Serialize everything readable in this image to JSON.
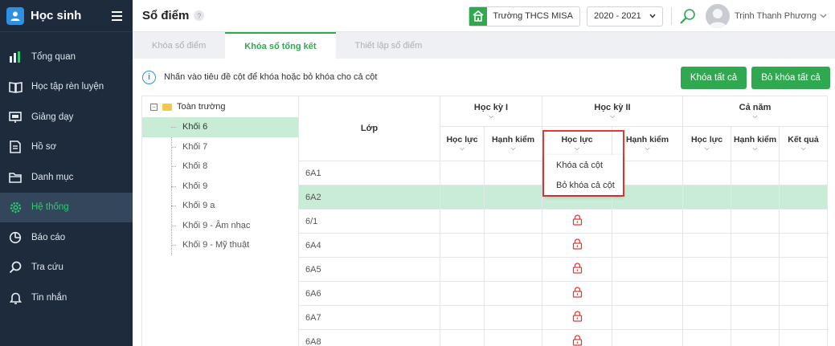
{
  "app": {
    "title": "Học sinh"
  },
  "sidebar": {
    "items": [
      {
        "label": "Tổng quan",
        "icon": "bar-chart-icon",
        "active": false
      },
      {
        "label": "Học tập rèn luyện",
        "icon": "book-icon",
        "active": false
      },
      {
        "label": "Giảng dạy",
        "icon": "board-icon",
        "active": false
      },
      {
        "label": "Hồ sơ",
        "icon": "document-icon",
        "active": false
      },
      {
        "label": "Danh mục",
        "icon": "folder-icon",
        "active": false
      },
      {
        "label": "Hệ thống",
        "icon": "gear-icon",
        "active": true
      },
      {
        "label": "Báo cáo",
        "icon": "pie-chart-icon",
        "active": false
      },
      {
        "label": "Tra cứu",
        "icon": "search-icon",
        "active": false
      },
      {
        "label": "Tin nhắn",
        "icon": "bell-icon",
        "active": false
      }
    ]
  },
  "header": {
    "title": "Sổ điểm",
    "help": "?",
    "school": "Trường THCS MISA",
    "year": "2020 - 2021",
    "user": "Trịnh Thanh Phương"
  },
  "tabs": [
    {
      "label": "Khóa sổ điểm",
      "active": false
    },
    {
      "label": "Khóa sổ tổng kết",
      "active": true
    },
    {
      "label": "Thiết lập sổ điểm",
      "active": false
    }
  ],
  "info": {
    "text": "Nhấn vào tiêu đề cột để khóa hoặc bỏ khóa cho cả cột",
    "lock_all": "Khóa tất cả",
    "unlock_all": "Bỏ khóa tất cả"
  },
  "tree": {
    "root": "Toàn trường",
    "items": [
      "Khối 6",
      "Khối 7",
      "Khối 8",
      "Khối 9",
      "Khối 9 a",
      "Khối 9 - Âm nhạc",
      "Khối 9 - Mỹ thuật"
    ],
    "selected_index": 0
  },
  "table": {
    "class_header": "Lớp",
    "groups": [
      "Học kỳ I",
      "Học kỳ II",
      "Cả năm"
    ],
    "sub": {
      "hk1_hocluc": "Học lực",
      "hk1_hanhkiem": "Hạnh kiểm",
      "hk2_hocluc": "Học lực",
      "hk2_hanhkiem": "Hạnh kiểm",
      "cn_hocluc": "Học lực",
      "cn_hanhkiem": "Hạnh kiểm",
      "cn_ketqua": "Kết quả"
    },
    "rows": [
      "6A1",
      "6A2",
      "6/1",
      "6A4",
      "6A5",
      "6A6",
      "6A7",
      "6A8"
    ]
  },
  "dropdown": {
    "lock_column": "Khóa cả cột",
    "unlock_column": "Bỏ khóa cả cột"
  },
  "colors": {
    "accent": "#2fa84f",
    "sidebar": "#1e2b3c",
    "highlight": "#c9ecd6",
    "lock": "#e53935"
  }
}
